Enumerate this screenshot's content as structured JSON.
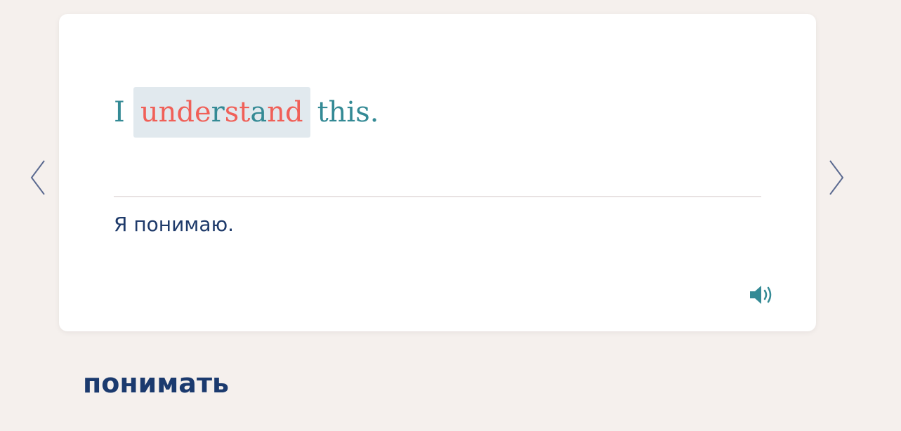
{
  "sentence": {
    "before": "I",
    "target_parts": [
      {
        "text": "unde",
        "highlight": true
      },
      {
        "text": "r",
        "highlight": false
      },
      {
        "text": "st",
        "highlight": true
      },
      {
        "text": "a",
        "highlight": false
      },
      {
        "text": "nd",
        "highlight": true
      }
    ],
    "after": "this."
  },
  "translation": "Я понимаю.",
  "vocab_word": "понимать",
  "icons": {
    "prev": "chevron-left-icon",
    "next": "chevron-right-icon",
    "audio": "speaker-icon"
  },
  "colors": {
    "sentence": "#348a95",
    "highlight": "#f06058",
    "highlight_bg": "#e1e9ee",
    "translation": "#1e3a6a",
    "vocab": "#1b3a6e",
    "page_bg": "#f5f0ed"
  }
}
